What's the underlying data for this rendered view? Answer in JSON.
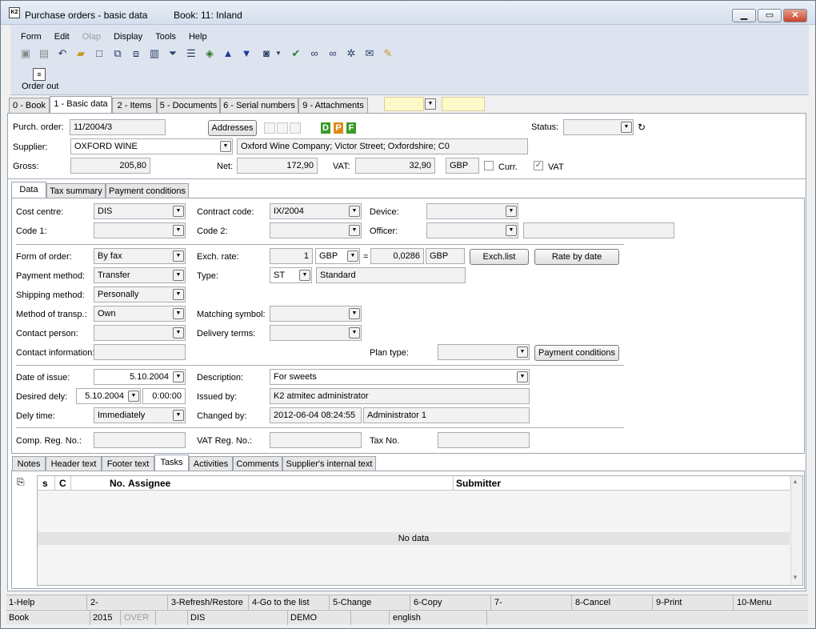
{
  "window": {
    "title": "Purchase orders - basic data",
    "book": "Book: 11: Inland"
  },
  "menu": [
    "Form",
    "Edit",
    "Olap",
    "Display",
    "Tools",
    "Help"
  ],
  "toolbar": {
    "order_out_label": "Order out"
  },
  "main_tabs": [
    "0 - Book",
    "1 - Basic data",
    "2 - Items",
    "5 - Documents",
    "6 - Serial numbers",
    "9 - Attachments"
  ],
  "header": {
    "purch_order_label": "Purch. order:",
    "purch_order": "11/2004/3",
    "addresses_button": "Addresses",
    "dpf": [
      "D",
      "P",
      "F"
    ],
    "status_label": "Status:",
    "status": "",
    "supplier_label": "Supplier:",
    "supplier": "OXFORD WINE",
    "supplier_address": "Oxford Wine Company; Victor Street; Oxfordshire; C0",
    "gross_label": "Gross:",
    "gross": "205,80",
    "net_label": "Net:",
    "net": "172,90",
    "vat_label": "VAT:",
    "vat": "32,90",
    "currency": "GBP",
    "curr_label": "Curr.",
    "vat_check_label": "VAT"
  },
  "sub_tabs": [
    "Data",
    "Tax summary",
    "Payment conditions"
  ],
  "data": {
    "cost_centre_label": "Cost centre:",
    "cost_centre": "DIS",
    "contract_code_label": "Contract code:",
    "contract_code": "IX/2004",
    "device_label": "Device:",
    "device": "",
    "code1_label": "Code 1:",
    "code1": "",
    "code2_label": "Code 2:",
    "code2": "",
    "officer_label": "Officer:",
    "officer": "",
    "officer_name": "",
    "form_of_order_label": "Form of order:",
    "form_of_order": "By fax",
    "exch_rate_label": "Exch. rate:",
    "exch_rate_amount": "1",
    "exch_rate_currency": "GBP",
    "exch_eq": "=",
    "exch_rate_value": "0,0286",
    "exch_rate_currency2": "GBP",
    "exch_list_button": "Exch.list",
    "rate_by_date_button": "Rate by date",
    "payment_method_label": "Payment method:",
    "payment_method": "Transfer",
    "type_label": "Type:",
    "type_code": "ST",
    "type_name": "Standard",
    "shipping_method_label": "Shipping method:",
    "shipping_method": "Personally",
    "method_transp_label": "Method of transp.:",
    "method_transp": "Own",
    "matching_symbol_label": "Matching symbol:",
    "matching_symbol": "",
    "contact_person_label": "Contact person:",
    "contact_person": "",
    "delivery_terms_label": "Delivery terms:",
    "delivery_terms": "",
    "contact_info_label": "Contact information:",
    "contact_info": "",
    "plan_type_label": "Plan type:",
    "plan_type": "",
    "payment_conditions_button": "Payment conditions",
    "date_of_issue_label": "Date of issue:",
    "date_of_issue": "5.10.2004",
    "description_label": "Description:",
    "description": "For sweets",
    "desired_dely_label": "Desired dely:",
    "desired_dely_date": "5.10.2004",
    "desired_dely_time": "0:00:00",
    "issued_by_label": "Issued by:",
    "issued_by": "K2 atmitec administrator",
    "dely_time_label": "Dely time:",
    "dely_time": "Immediately",
    "changed_by_label": "Changed by:",
    "changed_by_date": "2012-06-04 08:24:55",
    "changed_by_name": "Administrator 1",
    "comp_reg_label": "Comp. Reg. No.:",
    "comp_reg": "",
    "vat_reg_label": "VAT Reg. No.:",
    "vat_reg": "",
    "tax_no_label": "Tax No.",
    "tax_no": ""
  },
  "bottom_tabs": [
    "Notes",
    "Header text",
    "Footer text",
    "Tasks",
    "Activities",
    "Comments",
    "Supplier's internal text"
  ],
  "tasks_grid": {
    "columns": [
      "s",
      "C",
      "No.",
      "Assignee",
      "Submitter"
    ],
    "empty_text": "No data"
  },
  "fkeys": [
    "1-Help",
    "2-",
    "3-Refresh/Restore",
    "4-Go to the list",
    "5-Change",
    "6-Copy",
    "7-",
    "8-Cancel",
    "9-Print",
    "10-Menu"
  ],
  "statusbar": [
    "Book",
    "2015",
    "OVER",
    "",
    "DIS",
    "DEMO",
    "",
    "english"
  ]
}
